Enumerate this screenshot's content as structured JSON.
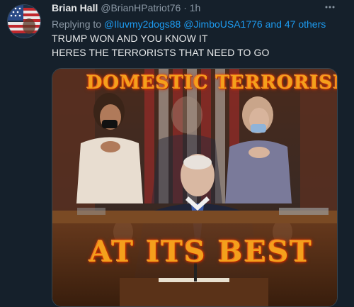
{
  "tweet": {
    "author_name": "Brian Hall",
    "author_handle": "@BrianHPatriot76",
    "separator": "·",
    "time": "1h",
    "replying_prefix": "Replying to",
    "mention_1": "@Iluvmy2dogs88",
    "mention_2": "@JimboUSA1776",
    "replying_suffix": "and 47 others",
    "text_line_1": "TRUMP WON AND YOU KNOW IT",
    "text_line_2": "HERES THE TERRORISTS THAT NEED TO GO"
  },
  "media": {
    "top_caption": "DOMESTIC TERRORISM",
    "bottom_caption": "AT ITS BEST"
  },
  "icons": {
    "avatar": "flag-avatar",
    "more": "more-options-icon"
  },
  "colors": {
    "background": "#15202b",
    "accent": "#1d9bf0",
    "secondary_text": "#8b98a5",
    "caption_fire": "#f4a01c"
  }
}
